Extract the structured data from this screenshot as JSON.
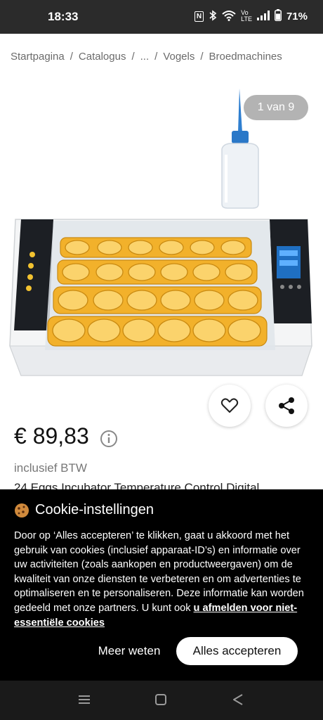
{
  "status_bar": {
    "time": "18:33",
    "battery": "71%",
    "icons": [
      "nfc-icon",
      "bluetooth-icon",
      "wifi-icon",
      "volte-icon",
      "signal-icon",
      "battery-icon"
    ]
  },
  "breadcrumb": [
    "Startpagina",
    "Catalogus",
    "...",
    "Vogels",
    "Broedmachines"
  ],
  "gallery": {
    "counter": "1 van 9"
  },
  "product": {
    "price": "€ 89,83",
    "vat_note": "inclusief BTW",
    "title_peek": "24 Eggs Incubator Temperature Control Digital"
  },
  "cookie_dialog": {
    "title": "Cookie-instellingen",
    "body": "Door op ‘Alles accepteren’ te klikken, gaat u akkoord met het gebruik van cookies (inclusief apparaat-ID’s) en informatie over uw activiteiten (zoals aankopen en productweergaven) om de kwaliteit van onze diensten te verbeteren en om advertenties te optimaliseren en te personaliseren. Deze informatie kan worden gedeeld met onze partners. U kunt ook ",
    "link": "u afmelden voor niet-essentiële cookies",
    "more_label": "Meer weten",
    "accept_label": "Alles accepteren"
  },
  "colors": {
    "status_bar": "#2b2b2b",
    "dialog_bg": "#000000",
    "tray_yellow": "#f2b12b",
    "counter_bg": "#b3b3b3"
  }
}
